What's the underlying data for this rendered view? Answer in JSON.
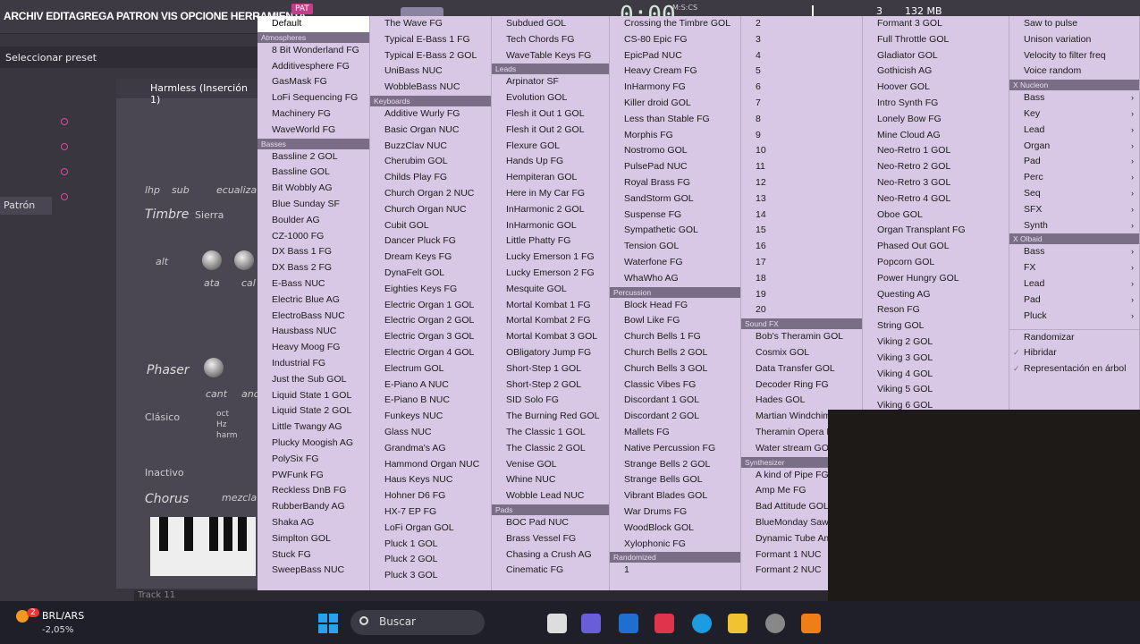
{
  "topbar": {
    "menu": "ARCHIV EDITAGREGA PATRON VIS OPCIONE HERRAMIENTA",
    "pat_badge": "PAT",
    "time": "0:00",
    "time_sub": "M:S:CS",
    "cpu": "3",
    "mem": "132 MB"
  },
  "preset": {
    "label": "Seleccionar preset"
  },
  "sidebar": {
    "patron": "Patrón"
  },
  "plugin": {
    "title": "Harmless (Inserción 1)",
    "lhp": "lhp",
    "sub": "sub",
    "ecualiza": "ecualiza",
    "timbre": "Timbre",
    "timbre_value": "Sierra",
    "alt": "alt",
    "ata": "ata",
    "cal": "cal",
    "phaser": "Phaser",
    "cant": "cant",
    "and": "and",
    "clasico": "Clásico",
    "oct": "oct",
    "hz": "Hz",
    "harm": "harm",
    "inactivo": "Inactivo",
    "chorus": "Chorus",
    "mezcla": "mezcla"
  },
  "track_label": "Track 11",
  "columns": [
    [
      {
        "t": "Default",
        "sel": true
      },
      {
        "h": "Atmospheres"
      },
      {
        "t": "8 Bit Wonderland FG"
      },
      {
        "t": "Additivesphere FG"
      },
      {
        "t": "GasMask FG"
      },
      {
        "t": "LoFi Sequencing FG"
      },
      {
        "t": "Machinery FG"
      },
      {
        "t": "WaveWorld FG"
      },
      {
        "h": "Basses"
      },
      {
        "t": "Bassline 2 GOL"
      },
      {
        "t": "Bassline GOL"
      },
      {
        "t": "Bit Wobbly AG"
      },
      {
        "t": "Blue Sunday SF"
      },
      {
        "t": "Boulder AG"
      },
      {
        "t": "CZ-1000 FG"
      },
      {
        "t": "DX Bass 1 FG"
      },
      {
        "t": "DX Bass 2 FG"
      },
      {
        "t": "E-Bass NUC"
      },
      {
        "t": "Electric Blue AG"
      },
      {
        "t": "ElectroBass NUC"
      },
      {
        "t": "Hausbass NUC"
      },
      {
        "t": "Heavy Moog FG"
      },
      {
        "t": "Industrial FG"
      },
      {
        "t": "Just the Sub GOL"
      },
      {
        "t": "Liquid State 1 GOL"
      },
      {
        "t": "Liquid State 2 GOL"
      },
      {
        "t": "Little Twangy AG"
      },
      {
        "t": "Plucky Moogish AG"
      },
      {
        "t": "PolySix FG"
      },
      {
        "t": "PWFunk FG"
      },
      {
        "t": "Reckless DnB FG"
      },
      {
        "t": "RubberBandy AG"
      },
      {
        "t": "Shaka AG"
      },
      {
        "t": "Simplton GOL"
      },
      {
        "t": "Stuck FG"
      },
      {
        "t": "SweepBass NUC"
      }
    ],
    [
      {
        "t": "The Wave FG"
      },
      {
        "t": "Typical E-Bass 1 FG"
      },
      {
        "t": "Typical E-Bass 2 GOL"
      },
      {
        "t": "UniBass NUC"
      },
      {
        "t": "WobbleBass NUC"
      },
      {
        "h": "Keyboards"
      },
      {
        "t": "Additive Wurly FG"
      },
      {
        "t": "Basic Organ NUC"
      },
      {
        "t": "BuzzClav NUC"
      },
      {
        "t": "Cherubim GOL"
      },
      {
        "t": "Childs Play FG"
      },
      {
        "t": "Church Organ 2 NUC"
      },
      {
        "t": "Church Organ NUC"
      },
      {
        "t": "Cubit GOL"
      },
      {
        "t": "Dancer Pluck FG"
      },
      {
        "t": "Dream Keys FG"
      },
      {
        "t": "DynaFelt GOL"
      },
      {
        "t": "Eighties Keys FG"
      },
      {
        "t": "Electric Organ 1 GOL"
      },
      {
        "t": "Electric Organ 2 GOL"
      },
      {
        "t": "Electric Organ 3 GOL"
      },
      {
        "t": "Electric Organ 4 GOL"
      },
      {
        "t": "Electrum GOL"
      },
      {
        "t": "E-Piano A NUC"
      },
      {
        "t": "E-Piano B NUC"
      },
      {
        "t": "Funkeys NUC"
      },
      {
        "t": "Glass NUC"
      },
      {
        "t": "Grandma's AG"
      },
      {
        "t": "Hammond Organ NUC"
      },
      {
        "t": "Haus Keys NUC"
      },
      {
        "t": "Hohner D6 FG"
      },
      {
        "t": "HX-7 EP FG"
      },
      {
        "t": "LoFi Organ GOL"
      },
      {
        "t": "Pluck 1 GOL"
      },
      {
        "t": "Pluck 2 GOL"
      },
      {
        "t": "Pluck 3 GOL"
      }
    ],
    [
      {
        "t": "Subdued GOL"
      },
      {
        "t": "Tech Chords FG"
      },
      {
        "t": "WaveTable Keys FG"
      },
      {
        "h": "Leads"
      },
      {
        "t": "Arpinator SF"
      },
      {
        "t": "Evolution GOL"
      },
      {
        "t": "Flesh it Out 1 GOL"
      },
      {
        "t": "Flesh it Out 2 GOL"
      },
      {
        "t": "Flexure GOL"
      },
      {
        "t": "Hands Up FG"
      },
      {
        "t": "Hempiteran GOL"
      },
      {
        "t": "Here in My Car FG"
      },
      {
        "t": "InHarmonic 2 GOL"
      },
      {
        "t": "InHarmonic GOL"
      },
      {
        "t": "Little Phatty FG"
      },
      {
        "t": "Lucky Emerson 1 FG"
      },
      {
        "t": "Lucky Emerson 2 FG"
      },
      {
        "t": "Mesquite GOL"
      },
      {
        "t": "Mortal Kombat 1 FG"
      },
      {
        "t": "Mortal Kombat 2 FG"
      },
      {
        "t": "Mortal Kombat 3 GOL"
      },
      {
        "t": "OBligatory Jump FG"
      },
      {
        "t": "Short-Step 1 GOL"
      },
      {
        "t": "Short-Step 2 GOL"
      },
      {
        "t": "SID Solo FG"
      },
      {
        "t": "The Burning Red GOL"
      },
      {
        "t": "The Classic 1 GOL"
      },
      {
        "t": "The Classic 2 GOL"
      },
      {
        "t": "Venise GOL"
      },
      {
        "t": "Whine NUC"
      },
      {
        "t": "Wobble Lead NUC"
      },
      {
        "h": "Pads"
      },
      {
        "t": "BOC Pad NUC"
      },
      {
        "t": "Brass Vessel FG"
      },
      {
        "t": "Chasing a Crush AG"
      },
      {
        "t": "Cinematic FG"
      }
    ],
    [
      {
        "t": "Crossing the Timbre GOL"
      },
      {
        "t": "CS-80 Epic FG"
      },
      {
        "t": "EpicPad NUC"
      },
      {
        "t": "Heavy Cream FG"
      },
      {
        "t": "InHarmony FG"
      },
      {
        "t": "Killer droid GOL"
      },
      {
        "t": "Less than Stable FG"
      },
      {
        "t": "Morphis FG"
      },
      {
        "t": "Nostromo GOL"
      },
      {
        "t": "PulsePad NUC"
      },
      {
        "t": "Royal Brass FG"
      },
      {
        "t": "SandStorm GOL"
      },
      {
        "t": "Suspense FG"
      },
      {
        "t": "Sympathetic GOL"
      },
      {
        "t": "Tension GOL"
      },
      {
        "t": "Waterfone FG"
      },
      {
        "t": "WhaWho AG"
      },
      {
        "h": "Percussion"
      },
      {
        "t": "Block Head FG"
      },
      {
        "t": "Bowl Like FG"
      },
      {
        "t": "Church Bells 1 FG"
      },
      {
        "t": "Church Bells 2 GOL"
      },
      {
        "t": "Church Bells 3 GOL"
      },
      {
        "t": "Classic Vibes FG"
      },
      {
        "t": "Discordant 1 GOL"
      },
      {
        "t": "Discordant 2 GOL"
      },
      {
        "t": "Mallets FG"
      },
      {
        "t": "Native Percussion FG"
      },
      {
        "t": "Strange Bells 2 GOL"
      },
      {
        "t": "Strange Bells GOL"
      },
      {
        "t": "Vibrant Blades GOL"
      },
      {
        "t": "War Drums FG"
      },
      {
        "t": "WoodBlock GOL"
      },
      {
        "t": "Xylophonic FG"
      },
      {
        "h": "Randomized"
      },
      {
        "t": "1"
      }
    ],
    [
      {
        "t": "2"
      },
      {
        "t": "3"
      },
      {
        "t": "4"
      },
      {
        "t": "5"
      },
      {
        "t": "6"
      },
      {
        "t": "7"
      },
      {
        "t": "8"
      },
      {
        "t": "9"
      },
      {
        "t": "10"
      },
      {
        "t": "11"
      },
      {
        "t": "12"
      },
      {
        "t": "13"
      },
      {
        "t": "14"
      },
      {
        "t": "15"
      },
      {
        "t": "16"
      },
      {
        "t": "17"
      },
      {
        "t": "18"
      },
      {
        "t": "19"
      },
      {
        "t": "20"
      },
      {
        "h": "Sound FX"
      },
      {
        "t": "Bob's Theramin GOL"
      },
      {
        "t": "Cosmix GOL"
      },
      {
        "t": "Data Transfer GOL"
      },
      {
        "t": "Decoder Ring FG"
      },
      {
        "t": "Hades GOL"
      },
      {
        "t": "Martian Windchim"
      },
      {
        "t": "Theramin Opera F"
      },
      {
        "t": "Water stream GOL"
      },
      {
        "h": "Synthesizer"
      },
      {
        "t": "A kind of Pipe FG"
      },
      {
        "t": "Amp Me FG"
      },
      {
        "t": "Bad Attitude GOL"
      },
      {
        "t": "BlueMonday Saws"
      },
      {
        "t": "Dynamic Tube Am"
      },
      {
        "t": "Formant 1 NUC"
      },
      {
        "t": "Formant 2 NUC"
      }
    ],
    [
      {
        "t": "Formant 3 GOL"
      },
      {
        "t": "Full Throttle GOL"
      },
      {
        "t": "Gladiator GOL"
      },
      {
        "t": "Gothicish AG"
      },
      {
        "t": "Hoover GOL"
      },
      {
        "t": "Intro Synth FG"
      },
      {
        "t": "Lonely Bow FG"
      },
      {
        "t": "Mine Cloud AG"
      },
      {
        "t": "Neo-Retro 1 GOL"
      },
      {
        "t": "Neo-Retro 2 GOL"
      },
      {
        "t": "Neo-Retro 3 GOL"
      },
      {
        "t": "Neo-Retro 4 GOL"
      },
      {
        "t": "Oboe GOL"
      },
      {
        "t": "Organ Transplant FG"
      },
      {
        "t": "Phased Out GOL"
      },
      {
        "t": "Popcorn GOL"
      },
      {
        "t": "Power Hungry GOL"
      },
      {
        "t": "Questing AG"
      },
      {
        "t": "Reson FG"
      },
      {
        "t": "String GOL"
      },
      {
        "t": "Viking 2 GOL"
      },
      {
        "t": "Viking 3 GOL"
      },
      {
        "t": "Viking 4 GOL"
      },
      {
        "t": "Viking 5 GOL"
      },
      {
        "t": "Viking 6 GOL"
      }
    ],
    [
      {
        "t": "Saw to pulse"
      },
      {
        "t": "Unison variation"
      },
      {
        "t": "Velocity to filter freq"
      },
      {
        "t": "Voice random"
      },
      {
        "h": "X Nucleon"
      },
      {
        "t": "Bass",
        "a": true
      },
      {
        "t": "Key",
        "a": true
      },
      {
        "t": "Lead",
        "a": true
      },
      {
        "t": "Organ",
        "a": true
      },
      {
        "t": "Pad",
        "a": true
      },
      {
        "t": "Perc",
        "a": true
      },
      {
        "t": "Seq",
        "a": true
      },
      {
        "t": "SFX",
        "a": true
      },
      {
        "t": "Synth",
        "a": true
      },
      {
        "h": "X Olbaid"
      },
      {
        "t": "Bass",
        "a": true
      },
      {
        "t": "FX",
        "a": true
      },
      {
        "t": "Lead",
        "a": true
      },
      {
        "t": "Pad",
        "a": true
      },
      {
        "t": "Pluck",
        "a": true
      },
      {
        "sep": true,
        "t": "Randomizar"
      },
      {
        "t": "Hibridar",
        "c": true
      },
      {
        "t": "Representación en árbol",
        "c": true
      }
    ]
  ],
  "taskbar": {
    "ticker": "BRL/ARS",
    "ticker_pct": "-2,05%",
    "badge": "2",
    "search": "Buscar"
  },
  "icons": {
    "arrow": "›",
    "check": "✓"
  }
}
